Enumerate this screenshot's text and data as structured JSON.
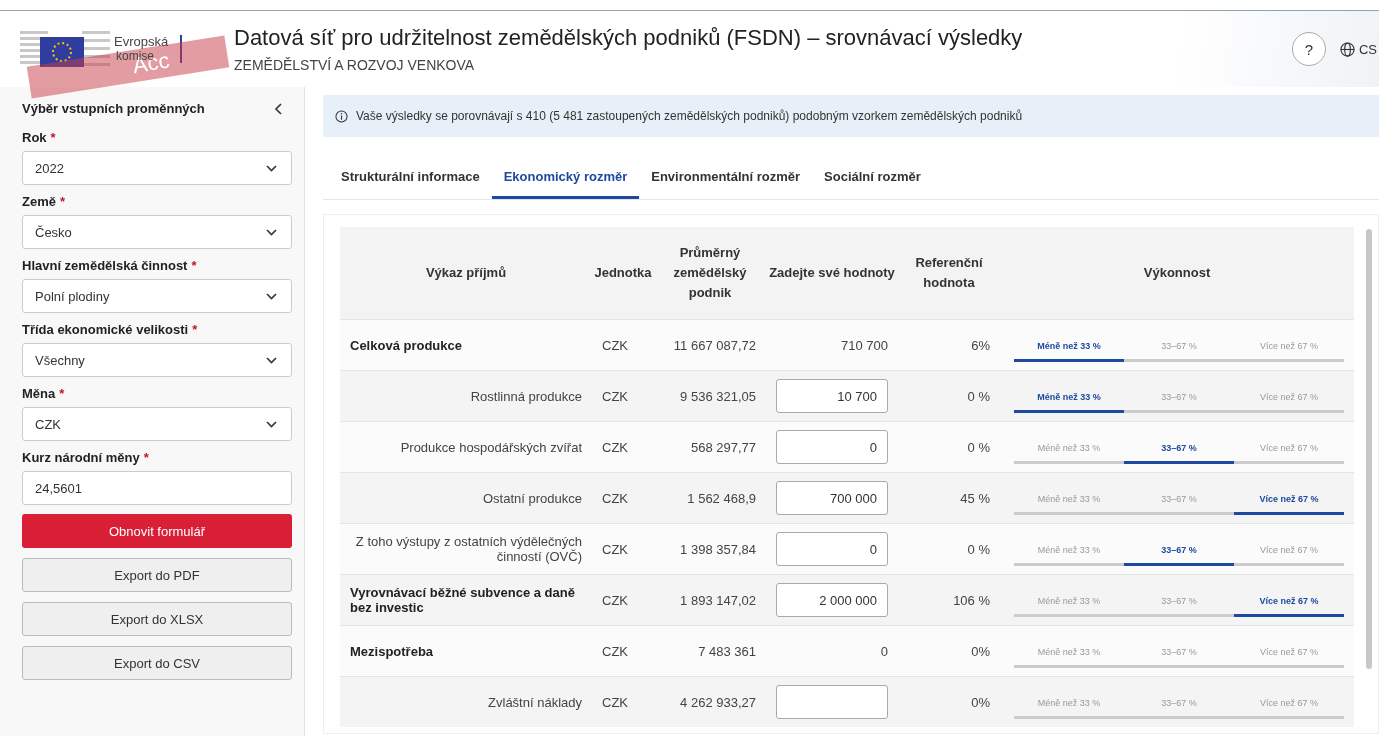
{
  "header": {
    "ribbon": "Acc",
    "logo_line1": "Evropská",
    "logo_line2": "komise",
    "title": "Datová síť pro udržitelnost zemědělských podniků (FSDN) – srovnávací výsledky",
    "subtitle": "ZEMĚDĚLSTVÍ A ROZVOJ VENKOVA",
    "help": "?",
    "language": "CS"
  },
  "sidebar": {
    "title": "Výběr vstupních proměnných",
    "fields": [
      {
        "label": "Rok",
        "required_mark": "*",
        "kind": "select",
        "value": "2022"
      },
      {
        "label": "Země",
        "required_mark": "*",
        "kind": "select",
        "value": "Česko"
      },
      {
        "label": "Hlavní zemědělská činnost",
        "required_mark": "*",
        "kind": "select",
        "value": "Polní plodiny"
      },
      {
        "label": "Třída ekonomické velikosti",
        "required_mark": "*",
        "kind": "select",
        "value": "Všechny"
      },
      {
        "label": "Měna",
        "required_mark": "*",
        "kind": "select",
        "value": "CZK"
      },
      {
        "label": "Kurz národní měny",
        "required_mark": "*",
        "kind": "input",
        "value": "24,5601"
      }
    ],
    "buttons": [
      {
        "label": "Obnovit formulář",
        "kind": "primary"
      },
      {
        "label": "Export do PDF",
        "kind": "secondary"
      },
      {
        "label": "Export do XLSX",
        "kind": "secondary"
      },
      {
        "label": "Export do CSV",
        "kind": "secondary"
      }
    ]
  },
  "info": "Vaše výsledky se porovnávají s 410 (5 481 zastoupených zemědělských podniků) podobným vzorkem zemědělských podniků",
  "tabs": [
    {
      "label": "Strukturální informace",
      "selected": false
    },
    {
      "label": "Ekonomický rozměr",
      "selected": true
    },
    {
      "label": "Environmentální rozměr",
      "selected": false
    },
    {
      "label": "Sociální rozměr",
      "selected": false
    }
  ],
  "table": {
    "columns": [
      "Výkaz příjmů",
      "Jednotka",
      "Průměrný zemědělský podnik",
      "Zadejte své hodnoty",
      "Referenční hodnota",
      "Výkonnost"
    ],
    "rows": [
      {
        "kind": "total",
        "name": "Celková produkce",
        "unit": "CZK",
        "average": "11 667 087,72",
        "editable": false,
        "value": "710 700",
        "reference": "6%",
        "performance": [
          {
            "label": "Méně než 33 %",
            "selected": true
          },
          {
            "label": "33–67 %",
            "selected": false
          },
          {
            "label": "Více než 67 %",
            "selected": false
          }
        ]
      },
      {
        "kind": "sub",
        "name": "Rostlinná produkce",
        "unit": "CZK",
        "average": "9 536 321,05",
        "editable": true,
        "value": "10 700",
        "reference": "0 %",
        "performance": [
          {
            "label": "Méně než 33 %",
            "selected": true
          },
          {
            "label": "33–67 %",
            "selected": false
          },
          {
            "label": "Více než 67 %",
            "selected": false
          }
        ]
      },
      {
        "kind": "sub",
        "name": "Produkce hospodářských zvířat",
        "unit": "CZK",
        "average": "568 297,77",
        "editable": true,
        "value": "0",
        "reference": "0 %",
        "performance": [
          {
            "label": "Méně než 33 %",
            "selected": false
          },
          {
            "label": "33–67 %",
            "selected": true
          },
          {
            "label": "Více než 67 %",
            "selected": false
          }
        ]
      },
      {
        "kind": "sub",
        "name": "Ostatní produkce",
        "unit": "CZK",
        "average": "1 562 468,9",
        "editable": true,
        "value": "700 000",
        "reference": "45 %",
        "performance": [
          {
            "label": "Méně než 33 %",
            "selected": false
          },
          {
            "label": "33–67 %",
            "selected": false
          },
          {
            "label": "Více než 67 %",
            "selected": true
          }
        ]
      },
      {
        "kind": "sub",
        "name": "Z toho výstupy z ostatních výdělečných činností (OVČ)",
        "unit": "CZK",
        "average": "1 398 357,84",
        "editable": true,
        "value": "0",
        "reference": "0 %",
        "performance": [
          {
            "label": "Méně než 33 %",
            "selected": false
          },
          {
            "label": "33–67 %",
            "selected": true
          },
          {
            "label": "Více než 67 %",
            "selected": false
          }
        ]
      },
      {
        "kind": "total",
        "name": "Vyrovnávací běžné subvence a daně bez investic",
        "unit": "CZK",
        "average": "1 893 147,02",
        "editable": true,
        "value": "2 000 000",
        "reference": "106 %",
        "performance": [
          {
            "label": "Méně než 33 %",
            "selected": false
          },
          {
            "label": "33–67 %",
            "selected": false
          },
          {
            "label": "Více než 67 %",
            "selected": true
          }
        ]
      },
      {
        "kind": "total",
        "name": "Mezispotřeba",
        "unit": "CZK",
        "average": "7 483 361",
        "editable": false,
        "value": "0",
        "reference": "0%",
        "performance": [
          {
            "label": "Méně než 33 %",
            "selected": false
          },
          {
            "label": "33–67 %",
            "selected": false
          },
          {
            "label": "Více než 67 %",
            "selected": false
          }
        ]
      },
      {
        "kind": "sub",
        "name": "Zvláštní náklady",
        "unit": "CZK",
        "average": "4 262 933,27",
        "editable": true,
        "reference": "0%",
        "performance": [
          {
            "label": "Méně než 33 %",
            "selected": false
          },
          {
            "label": "33–67 %",
            "selected": false
          },
          {
            "label": "Více než 67 %",
            "selected": false
          }
        ]
      }
    ]
  }
}
